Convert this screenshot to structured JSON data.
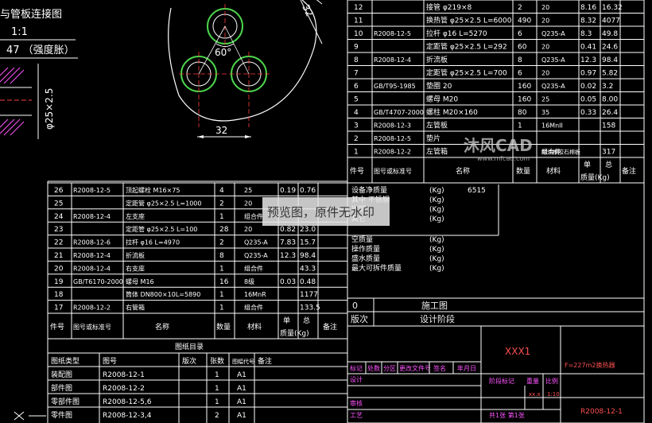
{
  "detail": {
    "title": "与管板连接图",
    "scale": "1:1",
    "note": "47 （强度胀）",
    "dim_pipe": "φ25×2.5",
    "dim_60": "60°",
    "dim_32a": "32",
    "dim_32b": "32"
  },
  "top_parts": {
    "rows": [
      {
        "no": "12",
        "code": "",
        "name": "接管 φ219×8",
        "qty": "2",
        "mat": "20",
        "w1": "8.16",
        "w2": "16.32"
      },
      {
        "no": "11",
        "code": "",
        "name": "换热管 φ25×2.5 L=6000",
        "qty": "490",
        "mat": "20",
        "w1": "8.32",
        "w2": "4077"
      },
      {
        "no": "10",
        "code": "R2008-12-5",
        "name": "拉杆 φ16 L=5270",
        "qty": "6",
        "mat": "Q235-A",
        "w1": "8.3",
        "w2": "49.8"
      },
      {
        "no": "9",
        "code": "",
        "name": "定距管 φ25×2.5 L=292",
        "qty": "60",
        "mat": "20",
        "w1": "0.41",
        "w2": "24.6"
      },
      {
        "no": "8",
        "code": "R2008-12-4",
        "name": "折流板",
        "qty": "8",
        "mat": "Q235-A",
        "w1": "12.3",
        "w2": "98.4"
      },
      {
        "no": "7",
        "code": "",
        "name": "定距管 φ25×2.5 L=700",
        "qty": "6",
        "mat": "20",
        "w1": "0.97",
        "w2": "5.82"
      },
      {
        "no": "6",
        "code": "GB/T95-1985",
        "name": "垫圈 20",
        "qty": "160",
        "mat": "Q235-A",
        "w1": "0.02",
        "w2": "3.2"
      },
      {
        "no": "5",
        "code": "",
        "name": "螺母 M20",
        "qty": "160",
        "mat": "25",
        "w1": "0.05",
        "w2": "8.00"
      },
      {
        "no": "4",
        "code": "GB/T4707-2000",
        "name": "螺柱 M20×160",
        "qty": "80",
        "mat": "35",
        "w1": "0.33",
        "w2": "26.4"
      },
      {
        "no": "3",
        "code": "R2008-12-3",
        "name": "左管板",
        "qty": "1",
        "mat": "16MnII",
        "w1": "",
        "w2": "158"
      },
      {
        "no": "2",
        "code": "R2008-12-5",
        "name": "垫片",
        "qty": "",
        "mat": "",
        "w1": "",
        "w2": ""
      },
      {
        "no": "1",
        "code": "R2008-12-2",
        "name": "左管箱",
        "qty": "",
        "mat": "组合件",
        "w1": "",
        "w2": "317"
      }
    ],
    "gasket_mat": "耐油橡胶石棉板",
    "header": {
      "no": "件号",
      "code": "图号或标准号",
      "name": "名称",
      "qty": "数量",
      "mat": "材料",
      "single": "单",
      "total": "总",
      "unit": "质量(Kg)",
      "note": "备注"
    }
  },
  "bottom_parts": {
    "rows": [
      {
        "no": "26",
        "code": "R2008-12-5",
        "name": "顶起螺栓 M16×75",
        "qty": "4",
        "mat": "25",
        "w1": "0.19",
        "w2": "0.76"
      },
      {
        "no": "25",
        "code": "",
        "name": "定距管 φ25×2.5 L=1000",
        "qty": "2",
        "mat": "20",
        "w1": "",
        "w2": ""
      },
      {
        "no": "24",
        "code": "R2008-12-4",
        "name": "左支座",
        "qty": "1",
        "mat": "组合件",
        "w1": "",
        "w2": ""
      },
      {
        "no": "23",
        "code": "",
        "name": "定距管 φ25×2.5 L=100",
        "qty": "28",
        "mat": "20",
        "w1": "0.82",
        "w2": "23.0"
      },
      {
        "no": "22",
        "code": "R2008-12-6",
        "name": "拉杆 φ16 L=4970",
        "qty": "2",
        "mat": "Q235-A",
        "w1": "7.83",
        "w2": "15.7"
      },
      {
        "no": "21",
        "code": "R2008-12-4",
        "name": "折流板",
        "qty": "8",
        "mat": "Q235-A",
        "w1": "12.3",
        "w2": "98.4"
      },
      {
        "no": "20",
        "code": "R2008-12-4",
        "name": "右支座",
        "qty": "1",
        "mat": "组合件",
        "w1": "",
        "w2": "43.3"
      },
      {
        "no": "19",
        "code": "GB/T6170-2000",
        "name": "螺母 M16",
        "qty": "16",
        "mat": "8级",
        "w1": "0.03",
        "w2": "0.48"
      },
      {
        "no": "18",
        "code": "",
        "name": "筒体 DN800×10L=5890",
        "qty": "1",
        "mat": "16MnR",
        "w1": "",
        "w2": "1177"
      },
      {
        "no": "17",
        "code": "R2008-12-2",
        "name": "右管箱",
        "qty": "1",
        "mat": "组合件",
        "w1": "",
        "w2": "133.5"
      }
    ],
    "header": {
      "no": "件号",
      "code": "图号或标准号",
      "name": "名称",
      "qty": "数量",
      "mat": "材料",
      "single": "单",
      "total": "总",
      "unit": "质量(Kg)",
      "note": "备注"
    }
  },
  "drawing_list": {
    "title": "图纸目录",
    "header": [
      "图纸类型",
      "图号",
      "版次",
      "张数",
      "图幅代号",
      "备注"
    ],
    "rows": [
      [
        "装配图",
        "R2008-12-1",
        "",
        "1",
        "A1",
        ""
      ],
      [
        "部件图",
        "R2008-12-2",
        "",
        "1",
        "A1",
        ""
      ],
      [
        "零部件图",
        "R2008-12-5,6",
        "",
        "1",
        "A1",
        ""
      ],
      [
        "零件图",
        "R2008-12-3,4",
        "",
        "2",
        "A1",
        ""
      ]
    ]
  },
  "mass_table": {
    "rows": [
      {
        "label": "设备净质量",
        "unit": "(Kg)",
        "value": "6515"
      },
      {
        "label": "其中 不锈钢",
        "unit": "(Kg)",
        "value": ""
      },
      {
        "label": "碳钢",
        "unit": "(Kg)",
        "value": ""
      },
      {
        "label": "其它",
        "unit": "(Kg)",
        "value": ""
      },
      {
        "label": "空质量",
        "unit": "(Kg)",
        "value": ""
      },
      {
        "label": "操作质量",
        "unit": "(Kg)",
        "value": ""
      },
      {
        "label": "盛水质量",
        "unit": "(Kg)",
        "value": ""
      },
      {
        "label": "最大可拆件质量",
        "unit": "(Kg)",
        "value": ""
      }
    ]
  },
  "revision": {
    "row0_no": "0",
    "row0_desc": "施工图",
    "ver_label": "版次",
    "stage_label": "设计阶段"
  },
  "title_block": {
    "company": "XXX1",
    "drawing_title": "F=227m2换热器",
    "drawing_no": "R2008-12-1",
    "cells": [
      "标记",
      "处数",
      "分区",
      "更改文件号",
      "签名",
      "年月日"
    ],
    "design": "设计",
    "check": "审核",
    "process": "工艺",
    "stage_mark": "阶段标记",
    "weight": "重量",
    "scale": "比例",
    "scale_val": "1:10",
    "sheet": "共1张 第1张",
    "xx": "xx.x"
  },
  "watermark": {
    "preview": "预览图，原件无水印",
    "logo": "沐风CAD",
    "url": "www.mfcad.com"
  },
  "colors": {
    "line": "#ffffff",
    "green": "#4cd44c",
    "yellow": "#ffff55",
    "magenta": "#ff55ff",
    "red": "#ff3b3b",
    "cyan": "#00e5ff"
  }
}
